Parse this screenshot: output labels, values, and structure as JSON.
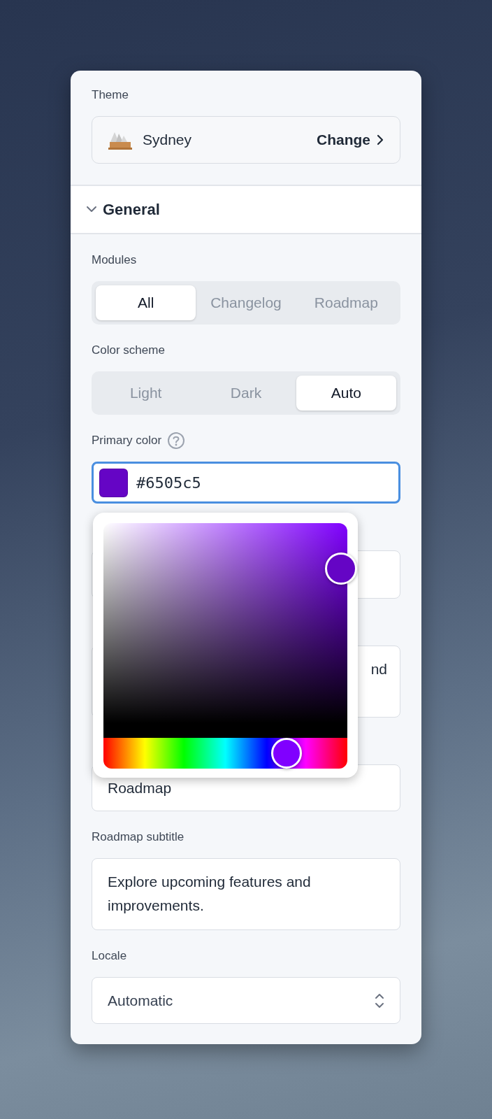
{
  "theme": {
    "label": "Theme",
    "name": "Sydney",
    "action": "Change"
  },
  "section": {
    "title": "General",
    "expanded": true
  },
  "modules": {
    "label": "Modules",
    "options": [
      {
        "label": "All",
        "selected": true
      },
      {
        "label": "Changelog",
        "selected": false
      },
      {
        "label": "Roadmap",
        "selected": false
      }
    ]
  },
  "color_scheme": {
    "label": "Color scheme",
    "options": [
      {
        "label": "Light",
        "selected": false
      },
      {
        "label": "Dark",
        "selected": false
      },
      {
        "label": "Auto",
        "selected": true
      }
    ]
  },
  "primary_color": {
    "label": "Primary color",
    "value": "#6505c5",
    "focused": true
  },
  "color_picker": {
    "open": true,
    "hue_slider": {
      "level": 0.75
    }
  },
  "fields": [
    {
      "kind": "input",
      "covered": true
    },
    {
      "kind": "textarea",
      "covered": true,
      "value": "nd"
    },
    {
      "kind": "input",
      "covered": true,
      "value": "Roadmap"
    },
    {
      "kind": "textarea",
      "covered": false,
      "label": "Roadmap subtitle",
      "value": "Explore upcoming features and improvements."
    },
    {
      "kind": "select",
      "covered": false,
      "label": "Locale",
      "value": "Automatic"
    }
  ]
}
